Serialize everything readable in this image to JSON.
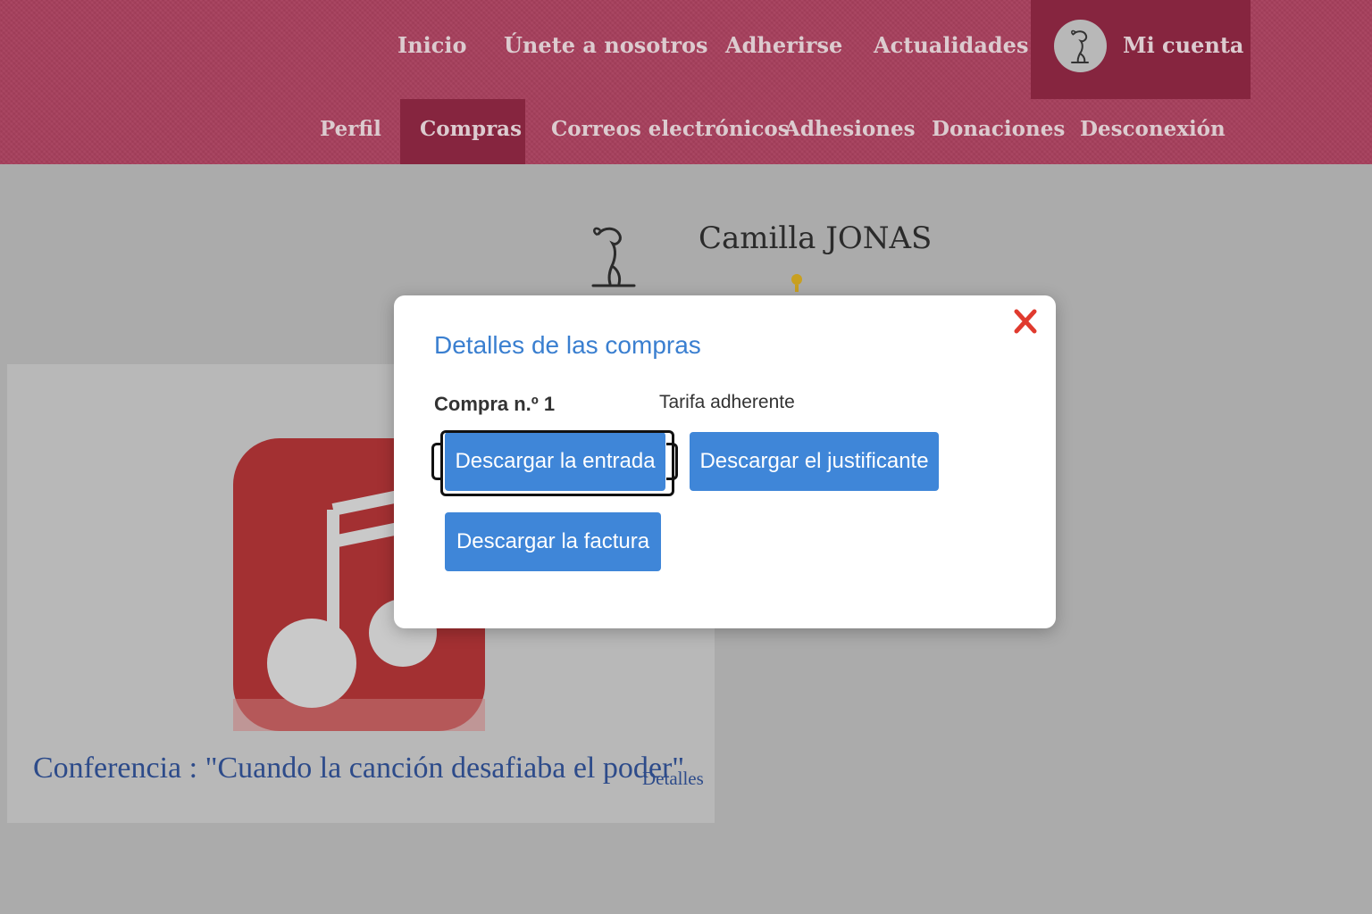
{
  "top_nav": {
    "items": [
      {
        "label": "Inicio"
      },
      {
        "label": "Únete a nosotros"
      },
      {
        "label": "Adherirse"
      },
      {
        "label": "Actualidades"
      }
    ],
    "account_label": "Mi cuenta"
  },
  "sub_nav": {
    "items": [
      {
        "label": "Perfil"
      },
      {
        "label": "Compras"
      },
      {
        "label": "Correos electrónicos"
      },
      {
        "label": "Adhesiones"
      },
      {
        "label": "Donaciones"
      },
      {
        "label": "Desconexión"
      }
    ],
    "active": "Compras"
  },
  "profile": {
    "name": "Camilla JONAS"
  },
  "event_card": {
    "title": "Conferencia : \"Cuando la canción desafiaba el poder\"",
    "details_link": "Detalles",
    "icon": "music-note-icon"
  },
  "modal": {
    "title": "Detalles de las compras",
    "purchase_label": "Compra n.º 1",
    "tariff": "Tarifa adherente",
    "buttons": {
      "ticket": "Descargar la entrada",
      "proof": "Descargar el justificante",
      "invoice": "Descargar la factura"
    },
    "close_icon": "close-icon"
  },
  "colors": {
    "header": "#a63f5c",
    "header_active": "#86253f",
    "button": "#3f86d8",
    "close": "#e03a2e",
    "app_icon": "#d32f2f",
    "title_link": "#2d4b8a"
  }
}
